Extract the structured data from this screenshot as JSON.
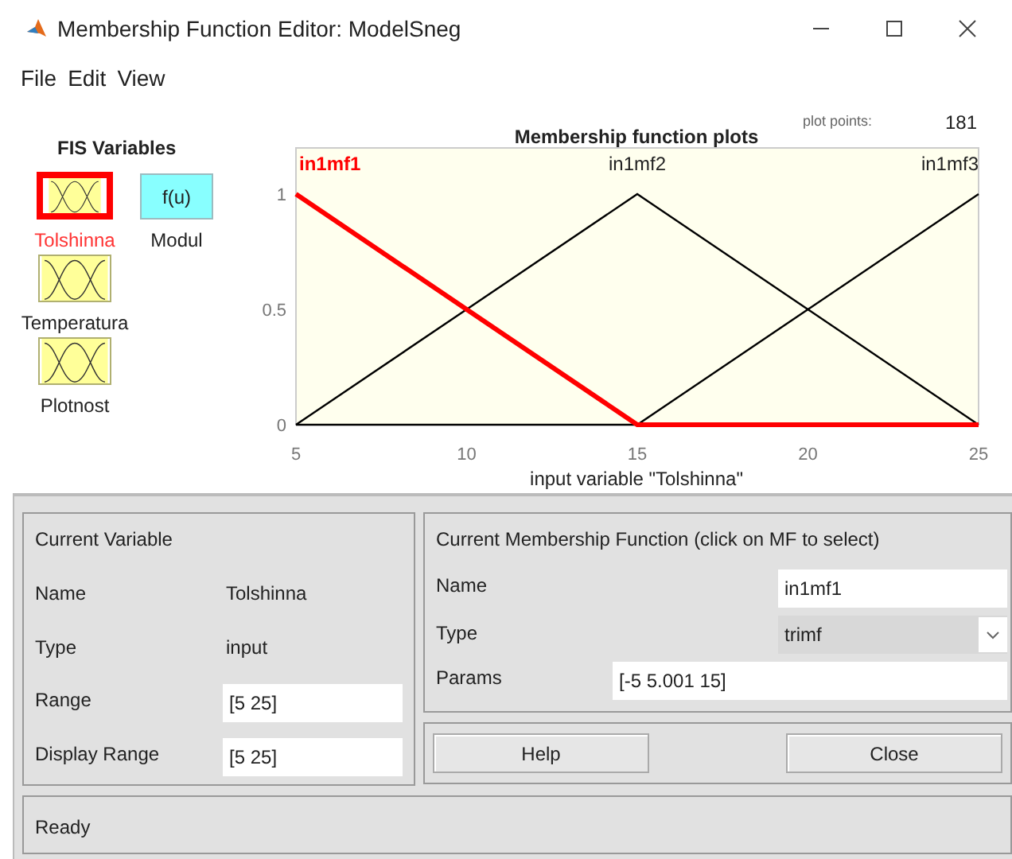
{
  "window": {
    "title": "Membership Function Editor: ModelSneg"
  },
  "menu": [
    "File",
    "Edit",
    "View"
  ],
  "fis_variables": {
    "title": "FIS Variables",
    "items": [
      {
        "label": "Tolshinna",
        "kind": "input",
        "selected": true
      },
      {
        "label": "Temperatura",
        "kind": "input",
        "selected": false
      },
      {
        "label": "Plotnost",
        "kind": "input",
        "selected": false
      },
      {
        "label": "Modul",
        "kind": "output",
        "icon_text": "f(u)",
        "selected": false
      }
    ]
  },
  "plot_points": {
    "label": "plot points:",
    "value": "181"
  },
  "plot": {
    "functions": [
      {
        "label": "in1mf1",
        "selected": true
      },
      {
        "label": "in1mf2",
        "selected": false
      },
      {
        "label": "in1mf3",
        "selected": false
      }
    ],
    "chart_data": {
      "type": "line",
      "title": "Membership function plots",
      "xlabel": "input variable \"Tolshinna\"",
      "x": [
        5,
        10,
        15,
        20,
        25
      ],
      "series": [
        {
          "color": "#ff0000",
          "values": [
            1,
            0.5,
            0,
            0,
            0
          ]
        },
        {
          "color": "#000000",
          "values": [
            0,
            0.5,
            1,
            0.5,
            0
          ]
        },
        {
          "color": "#000000",
          "values": [
            0,
            0,
            0,
            0.5,
            1
          ]
        }
      ],
      "xlim": [
        5,
        25
      ],
      "ylim": [
        0,
        1.2
      ],
      "xticks": [
        5,
        10,
        15,
        20,
        25
      ],
      "yticks": [
        0,
        0.5,
        1
      ]
    }
  },
  "current_variable": {
    "title": "Current Variable",
    "name_label": "Name",
    "name": "Tolshinna",
    "type_label": "Type",
    "type": "input",
    "range_label": "Range",
    "range": "[5 25]",
    "display_range_label": "Display Range",
    "display_range": "[5 25]"
  },
  "current_mf": {
    "title": "Current Membership Function (click on MF to select)",
    "name_label": "Name",
    "name": "in1mf1",
    "type_label": "Type",
    "type": "trimf",
    "params_label": "Params",
    "params": "[-5 5.001 15]"
  },
  "buttons": [
    "Help",
    "Close"
  ],
  "status_bar": "Ready"
}
